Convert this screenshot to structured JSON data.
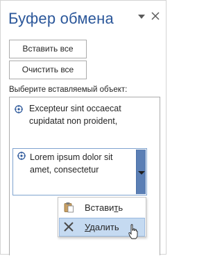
{
  "pane": {
    "title": "Буфер обмена",
    "paste_all_label": "Вставить все",
    "clear_all_label": "Очистить все",
    "prompt": "Выберите вставляемый объект:"
  },
  "clips": [
    {
      "text": "Excepteur sint occaecat cupidatat non proident,"
    },
    {
      "text": "Lorem ipsum dolor sit amet, consectetur"
    }
  ],
  "context_menu": {
    "paste_label_main": "Встави",
    "paste_label_accel": "т",
    "paste_label_tail": "ь",
    "delete_label_accel": "У",
    "delete_label_tail": "далить"
  },
  "colors": {
    "title": "#2b579a",
    "selection": "#c5daf1",
    "dropdown": "#5b7fb5"
  }
}
